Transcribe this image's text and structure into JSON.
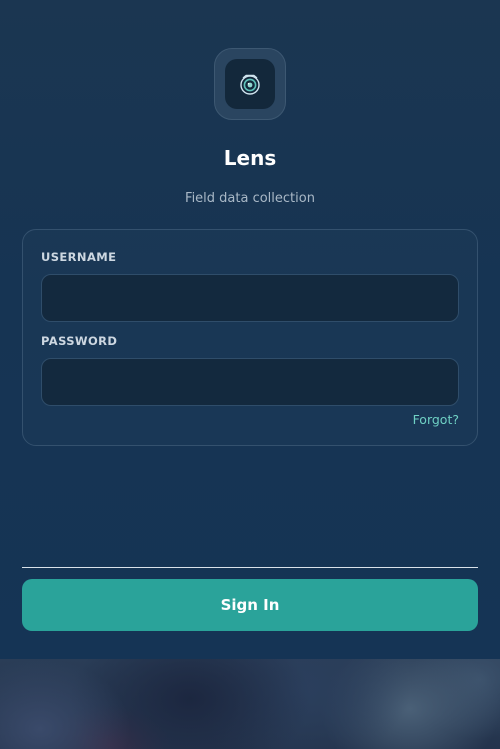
{
  "app": {
    "icon": "camera-lens-icon",
    "title": "Lens",
    "subtitle": "Field data collection"
  },
  "form": {
    "username": {
      "label": "USERNAME",
      "value": "",
      "placeholder": ""
    },
    "password": {
      "label": "PASSWORD",
      "value": "",
      "placeholder": ""
    },
    "forgot_label": "Forgot?",
    "submit_label": "Sign In"
  },
  "colors": {
    "accent": "#2aa39a",
    "link": "#6fd0c4",
    "background": "#163453",
    "input_bg": "#13293e"
  }
}
